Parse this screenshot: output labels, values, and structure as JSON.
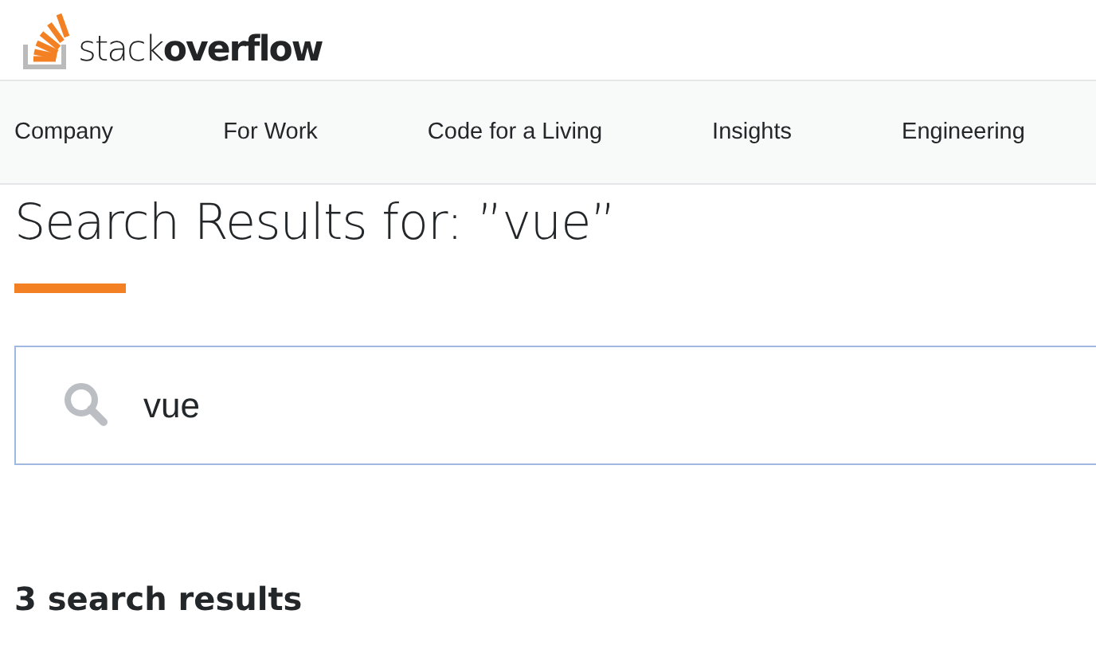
{
  "header": {
    "logo": "stack**overflow**"
  },
  "nav": {
    "items": [
      {
        "label": "Company"
      },
      {
        "label": "For Work"
      },
      {
        "label": "Code for a Living"
      },
      {
        "label": "Insights"
      },
      {
        "label": "Engineering"
      }
    ]
  },
  "page": {
    "title": "Search Results for: ”vue”"
  },
  "search": {
    "value": "vue"
  },
  "results": {
    "count_text": "3 search results"
  }
}
